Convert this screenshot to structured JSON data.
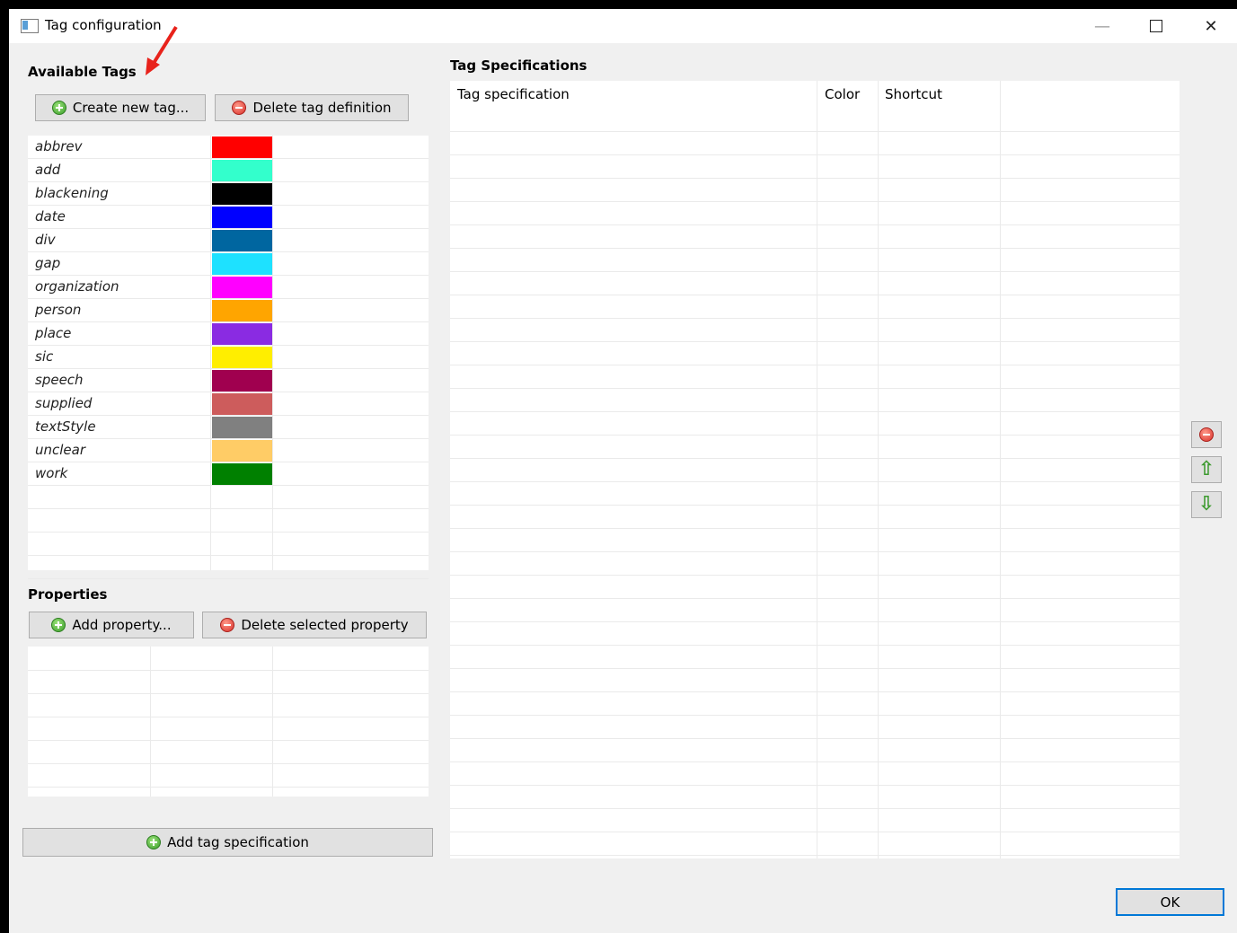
{
  "window": {
    "title": "Tag configuration"
  },
  "available_tags": {
    "heading": "Available Tags",
    "create_label": "Create new tag...",
    "delete_label": "Delete tag definition",
    "tags": [
      {
        "name": "abbrev",
        "color": "#ff0000"
      },
      {
        "name": "add",
        "color": "#33ffcc"
      },
      {
        "name": "blackening",
        "color": "#000000"
      },
      {
        "name": "date",
        "color": "#0000ff"
      },
      {
        "name": "div",
        "color": "#0066a0"
      },
      {
        "name": "gap",
        "color": "#1ee1ff"
      },
      {
        "name": "organization",
        "color": "#ff00ff"
      },
      {
        "name": "person",
        "color": "#ffa500"
      },
      {
        "name": "place",
        "color": "#8a2be2"
      },
      {
        "name": "sic",
        "color": "#ffee00"
      },
      {
        "name": "speech",
        "color": "#a0004f"
      },
      {
        "name": "supplied",
        "color": "#cd5c5c"
      },
      {
        "name": "textStyle",
        "color": "#808080"
      },
      {
        "name": "unclear",
        "color": "#ffcc66"
      },
      {
        "name": "work",
        "color": "#008000"
      }
    ]
  },
  "properties": {
    "heading": "Properties",
    "add_label": "Add property...",
    "delete_label": "Delete selected property"
  },
  "add_spec_label": "Add tag specification",
  "tag_specifications": {
    "heading": "Tag Specifications",
    "columns": [
      "Tag specification",
      "Color",
      "Shortcut"
    ]
  },
  "ok_label": "OK",
  "icons": {
    "add": "plus-circle-icon",
    "delete": "minus-circle-icon",
    "up": "arrow-up-icon",
    "down": "arrow-down-icon"
  }
}
